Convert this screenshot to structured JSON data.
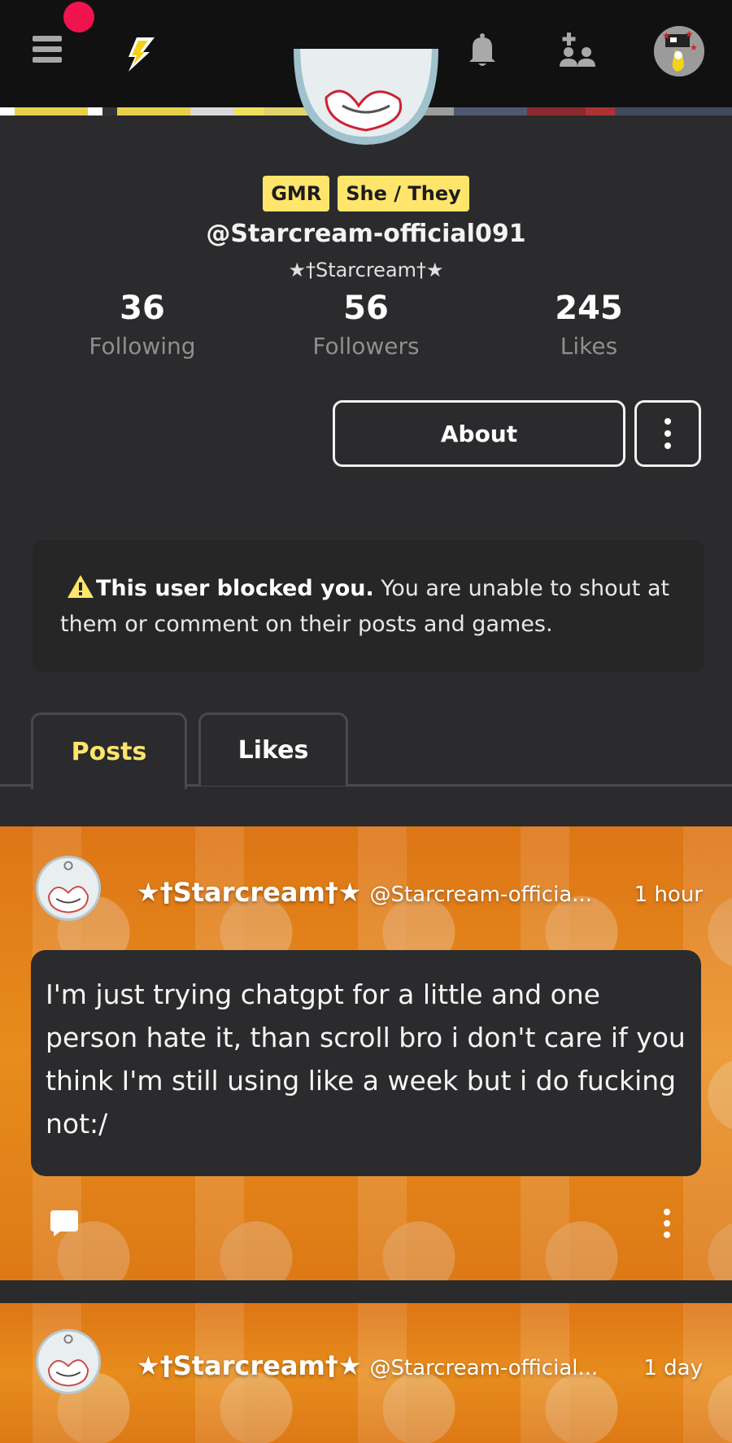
{
  "topbar": {
    "icons": [
      "menu-icon",
      "bolt-icon",
      "bell-icon",
      "friends-icon",
      "avatar"
    ]
  },
  "profile": {
    "badges": [
      "GMR",
      "She / They"
    ],
    "handle": "@Starcream-official091",
    "display_name": "★†Starcream†★",
    "stats": {
      "following": {
        "value": "36",
        "label": "Following"
      },
      "followers": {
        "value": "56",
        "label": "Followers"
      },
      "likes": {
        "value": "245",
        "label": "Likes"
      }
    },
    "about_label": "About"
  },
  "notice": {
    "bold": "This user blocked you.",
    "text": " You are unable to shout at them or comment on their posts and games."
  },
  "tabs": [
    {
      "label": "Posts",
      "active": true
    },
    {
      "label": "Likes",
      "active": false
    }
  ],
  "posts": [
    {
      "author": "★†Starcream†★",
      "handle": "@Starcream-officia...",
      "time": "1 hour",
      "body": "I'm just trying chatgpt for a little and one person hate it, than scroll bro i don't care if you think I'm still using like a week but i do fucking not:/"
    },
    {
      "author": "★†Starcream†★",
      "handle": "@Starcream-official...",
      "time": "1 day"
    }
  ],
  "colors": {
    "badge_bg": "#ffe56b",
    "active_tab": "#ffe56b",
    "notification_dot": "#f0134d",
    "post_bg": "#e88a1c"
  }
}
